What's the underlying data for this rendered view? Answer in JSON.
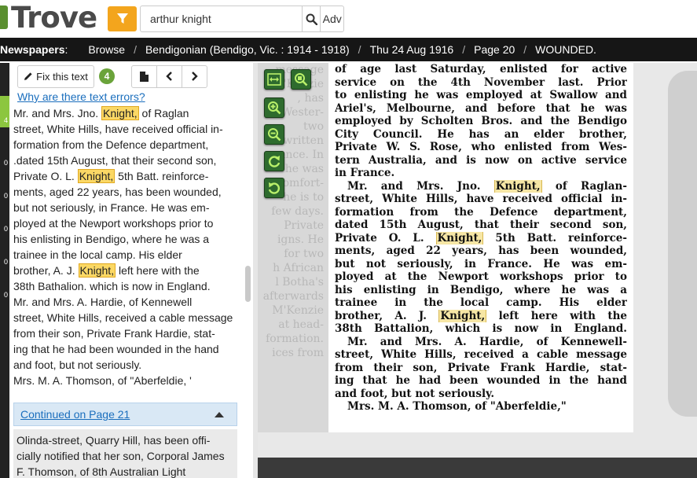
{
  "header": {
    "logo_text": "Trove",
    "search_value": "arthur knight",
    "search_placeholder": "",
    "adv_label": "Adv"
  },
  "breadcrumbs": [
    "Newspapers",
    "Browse",
    "Bendigonian (Bendigo, Vic. : 1914 - 1918)",
    "Thu 24 Aug 1916",
    "Page 20",
    "WOUNDED."
  ],
  "gutter": {
    "counts": [
      "4",
      "0",
      "0",
      "0",
      "0",
      "0"
    ]
  },
  "text_panel": {
    "fix_label": "Fix this text",
    "correction_count": "4",
    "why_link": "Why are there text errors?",
    "ocr_lines": [
      {
        "pre": "Mr. and Mrs. Jno. ",
        "hl": "Knight,",
        "post": " of Raglan"
      },
      {
        "pre": "street, White Hills, have received official in-",
        "hl": "",
        "post": ""
      },
      {
        "pre": "formation from the Defence department,",
        "hl": "",
        "post": ""
      },
      {
        "pre": ".dated 15th August, that their second son,",
        "hl": "",
        "post": ""
      },
      {
        "pre": "Private O. L. ",
        "hl": "Knight,",
        "post": " 5th Batt. reinforce-"
      },
      {
        "pre": "ments, aged 22 years, has been wounded,",
        "hl": "",
        "post": ""
      },
      {
        "pre": "but not seriously, in France. He was em-",
        "hl": "",
        "post": ""
      },
      {
        "pre": "ployed at the Newport workshops prior to",
        "hl": "",
        "post": ""
      },
      {
        "pre": "his enlisting in Bendigo, where he was a",
        "hl": "",
        "post": ""
      },
      {
        "pre": "trainee in the local camp. His elder",
        "hl": "",
        "post": ""
      },
      {
        "pre": "brother, A. J. ",
        "hl": "Knight,",
        "post": " left here with the"
      },
      {
        "pre": "38th Bathalion. which is now in England.",
        "hl": "",
        "post": ""
      },
      {
        "pre": "Mr. and Mrs. A. Hardie, of Kennewell",
        "hl": "",
        "post": ""
      },
      {
        "pre": "street, White Hills, received a cable message",
        "hl": "",
        "post": ""
      },
      {
        "pre": "from their son, Private Frank Hardie, stat-",
        "hl": "",
        "post": ""
      },
      {
        "pre": "ing that he had been wounded in the hand",
        "hl": "",
        "post": ""
      },
      {
        "pre": "and foot, but not seriously.",
        "hl": "",
        "post": ""
      },
      {
        "pre": "Mrs. M. A. Thomson, of \"Aberfeldie, '",
        "hl": "",
        "post": ""
      }
    ],
    "continued_label": "Continued on Page 21",
    "continued_lines": [
      "Olinda-street, Quarry Hill, has been offi-",
      "cially notified that her son, Corporal James",
      "F. Thomson, of 8th Australian Light"
    ]
  },
  "viewer": {
    "bg_lines": [
      "",
      "",
      "",
      "",
      "message",
      "M'Kenzie",
      ", has",
      "Wester-",
      "two",
      "written",
      "ance. In",
      "he was",
      "s comfort-",
      "he is to",
      "few days.",
      "Private",
      "igns. He",
      "for two",
      "h African",
      "l Botha's",
      "afterwards",
      "M'Kenzie",
      "at head-",
      "formation.",
      "ices from"
    ],
    "paper_lines": [
      {
        "pre": "of age last Saturday, enlisted for active",
        "hl": "",
        "post": ""
      },
      {
        "pre": "service on the 4th November last. Prior",
        "hl": "",
        "post": ""
      },
      {
        "pre": "to enlisting he was employed at Swallow and",
        "hl": "",
        "post": ""
      },
      {
        "pre": "Ariel's, Melbourne, and before that he was",
        "hl": "",
        "post": ""
      },
      {
        "pre": "employed by Scholten Bros. and the Bendigo",
        "hl": "",
        "post": ""
      },
      {
        "pre": "City Council. He has an elder brother,",
        "hl": "",
        "post": ""
      },
      {
        "pre": "Private W. S. Rose, who enlisted from Wes-",
        "hl": "",
        "post": ""
      },
      {
        "pre": "tern Australia, and is now on active service",
        "hl": "",
        "post": ""
      },
      {
        "pre": "in France.",
        "hl": "",
        "post": ""
      },
      {
        "pre": "Mr. and Mrs. Jno. ",
        "hl": "Knight,",
        "post": " of Raglan-"
      },
      {
        "pre": "street, White Hills, have received official in-",
        "hl": "",
        "post": ""
      },
      {
        "pre": "formation from the Defence department,",
        "hl": "",
        "post": ""
      },
      {
        "pre": "dated 15th August, that their second son,",
        "hl": "",
        "post": ""
      },
      {
        "pre": "Private O. L. ",
        "hl": "Knight,",
        "post": " 5th Batt. reinforce-"
      },
      {
        "pre": "ments, aged 22 years, has been wounded,",
        "hl": "",
        "post": ""
      },
      {
        "pre": "but not seriously, in France. He was em-",
        "hl": "",
        "post": ""
      },
      {
        "pre": "ployed at the Newport workshops prior to",
        "hl": "",
        "post": ""
      },
      {
        "pre": "his enlisting in Bendigo, where he was a",
        "hl": "",
        "post": ""
      },
      {
        "pre": "trainee in the local camp. His elder",
        "hl": "",
        "post": ""
      },
      {
        "pre": "brother, A. J. ",
        "hl": "Knight,",
        "post": " left here with the"
      },
      {
        "pre": "38th Battalion, which is now in England.",
        "hl": "",
        "post": ""
      },
      {
        "pre": "Mr. and Mrs. A. Hardie, of Kennewell-",
        "hl": "",
        "post": ""
      },
      {
        "pre": "street, White Hills, received a cable message",
        "hl": "",
        "post": ""
      },
      {
        "pre": "from their son, Private Frank Hardie, stat-",
        "hl": "",
        "post": ""
      },
      {
        "pre": "ing that he had been wounded in the hand",
        "hl": "",
        "post": ""
      },
      {
        "pre": "and foot, but not seriously.",
        "hl": "",
        "post": ""
      },
      {
        "pre": "Mrs. M. A. Thomson, of \"Aberfeldie,\"",
        "hl": "",
        "post": ""
      }
    ],
    "tools": [
      "fit-width-icon",
      "zoom-fit-icon",
      "zoom-in-icon",
      "zoom-out-icon",
      "rotate-right-icon",
      "rotate-left-icon"
    ]
  },
  "colors": {
    "accent": "#f3a51d",
    "highlight": "#fbd865",
    "breadcrumb_bg": "#161616",
    "link": "#1a6ebd",
    "viewer_button": "#2e6b2e"
  }
}
